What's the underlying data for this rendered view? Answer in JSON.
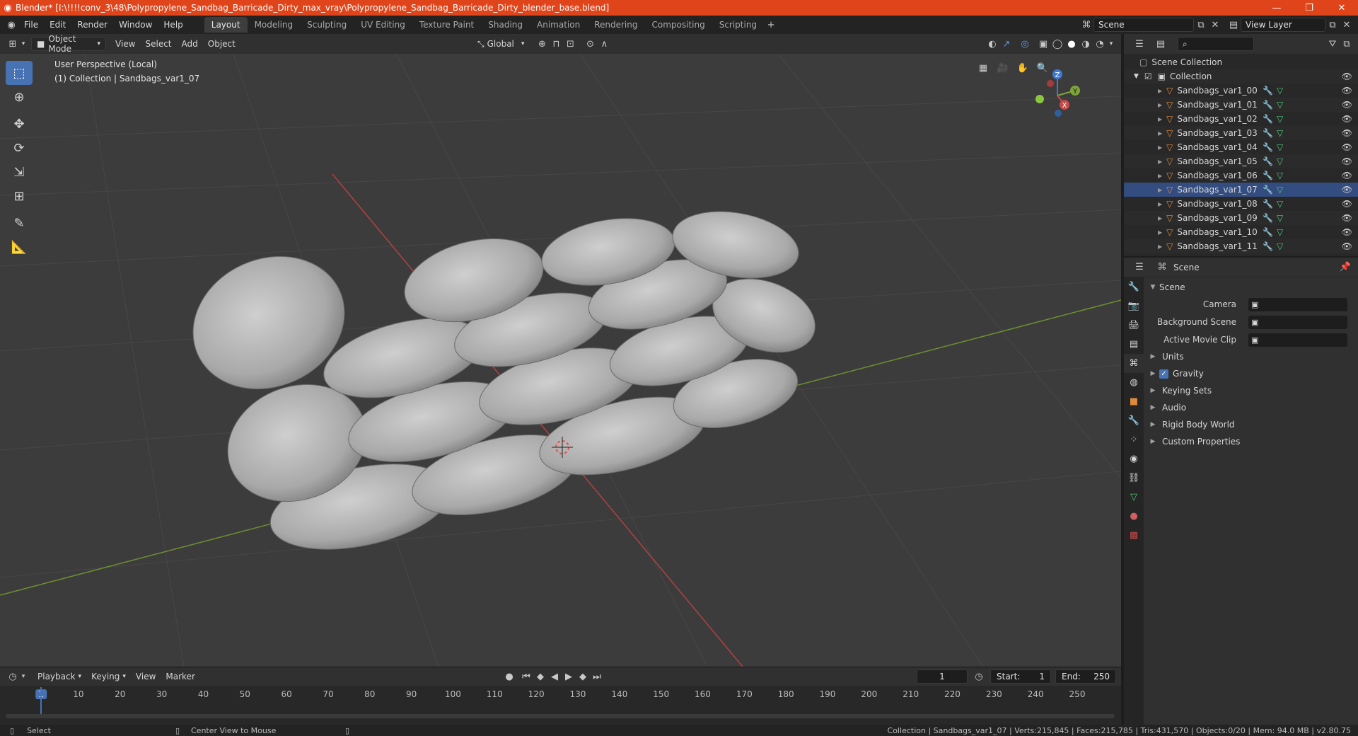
{
  "window": {
    "title": "Blender* [I:\\!!!!conv_3\\48\\Polypropylene_Sandbag_Barricade_Dirty_max_vray\\Polypropylene_Sandbag_Barricade_Dirty_blender_base.blend]",
    "minimize": "—",
    "maximize": "❐",
    "close": "✕"
  },
  "menu": [
    "File",
    "Edit",
    "Render",
    "Window",
    "Help"
  ],
  "workspaces": [
    "Layout",
    "Modeling",
    "Sculpting",
    "UV Editing",
    "Texture Paint",
    "Shading",
    "Animation",
    "Rendering",
    "Compositing",
    "Scripting"
  ],
  "active_workspace": "Layout",
  "scene_selector": "Scene",
  "view_layer": "View Layer",
  "viewport_header": {
    "mode": "Object Mode",
    "menus": [
      "View",
      "Select",
      "Add",
      "Object"
    ],
    "orientation": "Global"
  },
  "viewport": {
    "perspective": "User Perspective (Local)",
    "collection_info": "(1) Collection | Sandbags_var1_07",
    "gizmo_axes": {
      "z": "Z",
      "y": "Y",
      "x": "X"
    }
  },
  "outliner": {
    "root": "Scene Collection",
    "collection": "Collection",
    "objects": [
      "Sandbags_var1_00",
      "Sandbags_var1_01",
      "Sandbags_var1_02",
      "Sandbags_var1_03",
      "Sandbags_var1_04",
      "Sandbags_var1_05",
      "Sandbags_var1_06",
      "Sandbags_var1_07",
      "Sandbags_var1_08",
      "Sandbags_var1_09",
      "Sandbags_var1_10",
      "Sandbags_var1_11"
    ],
    "selected": "Sandbags_var1_07"
  },
  "properties": {
    "context": "Scene",
    "section": "Scene",
    "fields": [
      {
        "label": "Camera",
        "value": ""
      },
      {
        "label": "Background Scene",
        "value": ""
      },
      {
        "label": "Active Movie Clip",
        "value": ""
      }
    ],
    "panels": [
      {
        "label": "Units",
        "checkbox": false
      },
      {
        "label": "Gravity",
        "checkbox": true
      },
      {
        "label": "Keying Sets",
        "checkbox": false
      },
      {
        "label": "Audio",
        "checkbox": false
      },
      {
        "label": "Rigid Body World",
        "checkbox": false
      },
      {
        "label": "Custom Properties",
        "checkbox": false
      }
    ]
  },
  "timeline": {
    "menus": [
      "Playback",
      "Keying",
      "View",
      "Marker"
    ],
    "current_frame": "1",
    "start_label": "Start:",
    "start": "1",
    "end_label": "End:",
    "end": "250",
    "ticks": [
      "1",
      "10",
      "20",
      "30",
      "40",
      "50",
      "60",
      "70",
      "80",
      "90",
      "100",
      "110",
      "120",
      "130",
      "140",
      "150",
      "160",
      "170",
      "180",
      "190",
      "200",
      "210",
      "220",
      "230",
      "240",
      "250"
    ]
  },
  "statusbar": {
    "left_action": "Select",
    "middle_action": "Center View to Mouse",
    "stats": "Collection | Sandbags_var1_07 | Verts:215,845 | Faces:215,785 | Tris:431,570 | Objects:0/20 | Mem: 94.0 MB | v2.80.75"
  },
  "colors": {
    "accent": "#4772b3",
    "titlebar": "#e0441a",
    "selection": "#334d80",
    "x_axis": "#c64a4a",
    "y_axis": "#7fa53a",
    "z_axis": "#3b7bd6"
  }
}
